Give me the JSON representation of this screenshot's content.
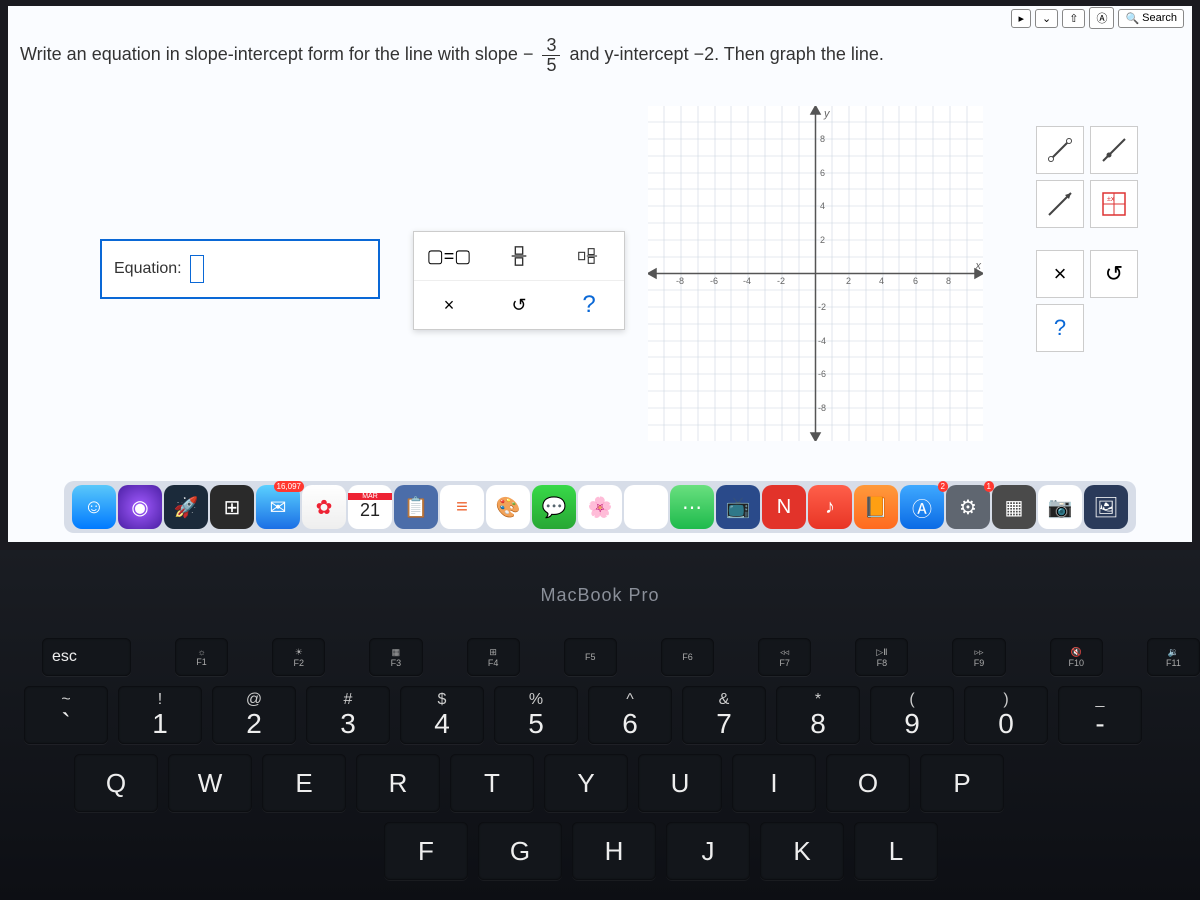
{
  "topbar": {
    "search_label": "Search"
  },
  "question": {
    "pre": "Write an equation in slope-intercept form for the line with slope ",
    "minus": "−",
    "num": "3",
    "den": "5",
    "post": " and y-intercept −2. Then graph the line."
  },
  "equation": {
    "label": "Equation:"
  },
  "toolbar": {
    "eq": "▢=▢",
    "cancel": "×",
    "undo": "↺",
    "help": "?"
  },
  "right": {
    "cancel": "×",
    "undo": "↺",
    "help": "?"
  },
  "graph": {
    "y_label": "y",
    "x_label": "x",
    "ticks_neg": [
      "-8",
      "-6",
      "-4",
      "-2"
    ],
    "ticks_pos": [
      "2",
      "4",
      "6",
      "8"
    ]
  },
  "dock": {
    "mail_badge": "16,097",
    "cal_month": "MAR",
    "cal_day": "21",
    "app_store_badge": "2",
    "settings_badge": "1"
  },
  "mb": {
    "label": "MacBook Pro"
  },
  "keys": {
    "esc": "esc",
    "fn": [
      "F1",
      "F2",
      "F3",
      "F4",
      "F5",
      "F6",
      "F7",
      "F8",
      "F9",
      "F10",
      "F11"
    ],
    "r1_sym": [
      "!",
      "@",
      "#",
      "$",
      "%",
      "^",
      "&",
      "*",
      "(",
      ")",
      "_"
    ],
    "r1_num": [
      "1",
      "2",
      "3",
      "4",
      "5",
      "6",
      "7",
      "8",
      "9",
      "0",
      "-"
    ],
    "tilde_sym": "~",
    "tilde": "`",
    "r2": [
      "Q",
      "W",
      "E",
      "R",
      "T",
      "Y",
      "U",
      "I",
      "O",
      "P"
    ],
    "r3": [
      "F",
      "G",
      "H",
      "J",
      "K",
      "L"
    ]
  }
}
